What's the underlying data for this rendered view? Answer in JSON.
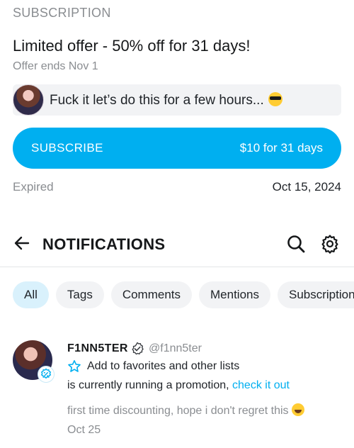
{
  "subscription": {
    "section_label": "SUBSCRIPTION",
    "offer_title": "Limited offer - 50% off for 31 days!",
    "offer_ends": "Offer ends Nov 1",
    "message": "Fuck it let’s do this for a few hours...",
    "message_emoji": "smiling-face-with-sunglasses-icon",
    "subscribe_label": "SUBSCRIBE",
    "subscribe_price": "$10 for 31 days",
    "status": "Expired",
    "status_date": "Oct 15, 2024",
    "accent_color": "#00aff0"
  },
  "notifications": {
    "title": "NOTIFICATIONS",
    "tabs": [
      {
        "label": "All",
        "active": true
      },
      {
        "label": "Tags",
        "active": false
      },
      {
        "label": "Comments",
        "active": false
      },
      {
        "label": "Mentions",
        "active": false
      },
      {
        "label": "Subscriptions",
        "active": false
      }
    ],
    "items": [
      {
        "name": "F1NN5TER",
        "handle": "@f1nn5ter",
        "favorites_label": "Add to favorites and other lists",
        "body": "is currently running a promotion,",
        "link_text": "check it out",
        "quote": "first time discounting, hope i don't regret this",
        "date": "Oct 25"
      }
    ]
  }
}
